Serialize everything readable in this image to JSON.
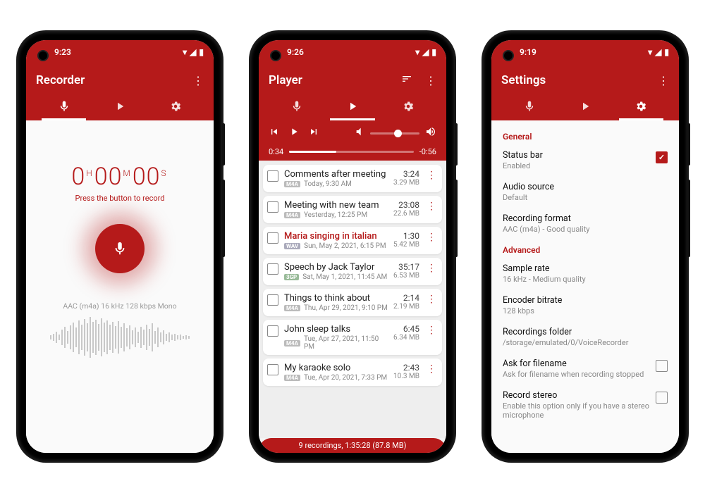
{
  "statusbar": {
    "times": [
      "9:23",
      "9:26",
      "9:19"
    ],
    "signal": "▾◢",
    "battery": "▮"
  },
  "recorder": {
    "title": "Recorder",
    "timer": {
      "h": "0",
      "m": "00",
      "s": "00",
      "H": "H",
      "M": "M",
      "S": "S"
    },
    "hint": "Press the button to record",
    "info": "AAC (m4a) 16 kHz 128 kbps Mono"
  },
  "player": {
    "title": "Player",
    "elapsed": "0:34",
    "remaining": "-0:56",
    "vol_pct": 55,
    "progress_pct": 38,
    "footer": "9 recordings, 1:35:28 (87.8 MB)",
    "items": [
      {
        "title": "Comments after meeting",
        "fmt": "M4A",
        "date": "Today, 9:30 AM",
        "dur": "3:24",
        "size": "3.29 MB",
        "playing": false
      },
      {
        "title": "Meeting with new team",
        "fmt": "M4A",
        "date": "Yesterday, 12:25 PM",
        "dur": "23:08",
        "size": "22.6 MB",
        "playing": false
      },
      {
        "title": "Maria singing in italian",
        "fmt": "WAV",
        "date": "Sun, May 2, 2021, 6:15 PM",
        "dur": "1:30",
        "size": "5.42 MB",
        "playing": true
      },
      {
        "title": "Speech by Jack Taylor",
        "fmt": "3GP",
        "date": "Sat, May 1, 2021, 11:45 AM",
        "dur": "35:17",
        "size": "6.53 MB",
        "playing": false
      },
      {
        "title": "Things to think about",
        "fmt": "M4A",
        "date": "Thu, Apr 29, 2021, 9:10 PM",
        "dur": "2:14",
        "size": "2.19 MB",
        "playing": false
      },
      {
        "title": "John sleep talks",
        "fmt": "M4A",
        "date": "Tue, Apr 27, 2021, 11:50 PM",
        "dur": "6:45",
        "size": "6.34 MB",
        "playing": false
      },
      {
        "title": "My karaoke solo",
        "fmt": "M4A",
        "date": "Tue, Apr 20, 2021, 7:33 PM",
        "dur": "2:43",
        "size": "10.3 MB",
        "playing": false
      }
    ]
  },
  "settings": {
    "title": "Settings",
    "sections": [
      {
        "label": "General",
        "items": [
          {
            "label": "Status bar",
            "sub": "Enabled",
            "checkbox": true,
            "checked": true
          },
          {
            "label": "Audio source",
            "sub": "Default",
            "checkbox": false
          },
          {
            "label": "Recording format",
            "sub": "AAC (m4a) - Good quality",
            "checkbox": false
          }
        ]
      },
      {
        "label": "Advanced",
        "items": [
          {
            "label": "Sample rate",
            "sub": "16 kHz - Medium quality",
            "checkbox": false
          },
          {
            "label": "Encoder bitrate",
            "sub": "128 kbps",
            "checkbox": false
          },
          {
            "label": "Recordings folder",
            "sub": "/storage/emulated/0/VoiceRecorder",
            "checkbox": false
          },
          {
            "label": "Ask for filename",
            "sub": "Ask for filename when recording stopped",
            "checkbox": true,
            "checked": false
          },
          {
            "label": "Record stereo",
            "sub": "Enable this option only if you have a stereo microphone",
            "checkbox": true,
            "checked": false
          }
        ]
      }
    ]
  }
}
